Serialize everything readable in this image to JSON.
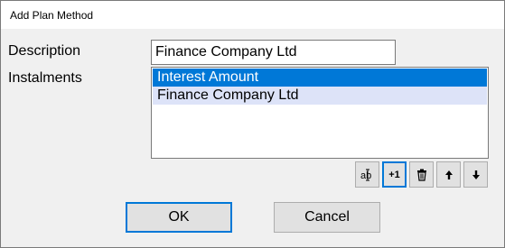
{
  "window": {
    "title": "Add Plan Method"
  },
  "form": {
    "description_label": "Description",
    "description_value": "Finance Company Ltd",
    "instalments_label": "Instalments"
  },
  "instalments": {
    "items": [
      {
        "label": "Interest Amount",
        "selected": true
      },
      {
        "label": "Finance Company Ltd",
        "selected": false
      }
    ]
  },
  "toolbar": {
    "edit_icon": "edit-cursor-icon",
    "add_one_label": "+1",
    "delete_icon": "trash-icon",
    "move_up_icon": "arrow-up-icon",
    "move_down_icon": "arrow-down-icon"
  },
  "buttons": {
    "ok_label": "OK",
    "cancel_label": "Cancel"
  },
  "colors": {
    "selection": "#0078d7",
    "alt_row": "#dde3f8",
    "focus_border": "#0078d7"
  }
}
